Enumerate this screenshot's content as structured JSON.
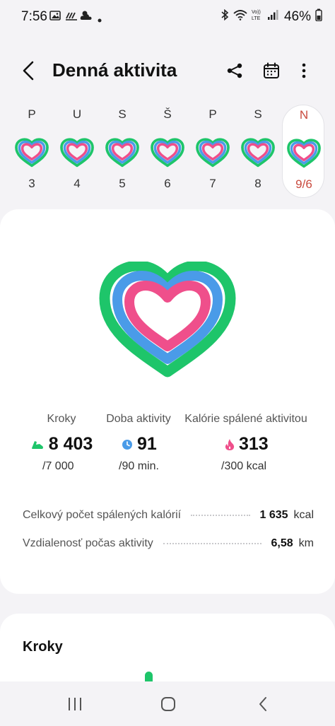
{
  "status": {
    "time": "7:56",
    "battery": "46%",
    "icons": [
      "image-icon",
      "weather-icon",
      "cloud-icon",
      "dot-icon",
      "bluetooth-icon",
      "wifi-icon",
      "volte-icon",
      "signal-icon",
      "battery-icon"
    ]
  },
  "header": {
    "title": "Denná aktivita",
    "back_icon": "back-arrow-icon",
    "actions": [
      "share-icon",
      "calendar-icon",
      "more-icon"
    ]
  },
  "week": [
    {
      "letter": "P",
      "date": "3",
      "selected": false
    },
    {
      "letter": "U",
      "date": "4",
      "selected": false
    },
    {
      "letter": "S",
      "date": "5",
      "selected": false
    },
    {
      "letter": "Š",
      "date": "6",
      "selected": false
    },
    {
      "letter": "P",
      "date": "7",
      "selected": false
    },
    {
      "letter": "S",
      "date": "8",
      "selected": false
    },
    {
      "letter": "N",
      "date": "9/6",
      "selected": true
    }
  ],
  "colors": {
    "steps": "#1ec56a",
    "active_time": "#4a9be8",
    "calories": "#ef4f8b",
    "selected_day": "#c94a3e"
  },
  "summary": {
    "stats": [
      {
        "label": "Kroky",
        "value": "8 403",
        "goal": "/7 000",
        "icon": "shoe-icon"
      },
      {
        "label": "Doba aktivity",
        "value": "91",
        "goal": "/90 min.",
        "icon": "clock-icon"
      },
      {
        "label": "Kalórie spálené aktivitou",
        "value": "313",
        "goal": "/300 kcal",
        "icon": "flame-icon"
      }
    ],
    "details": [
      {
        "label": "Celkový počet spálených kalórií",
        "value": "1 635",
        "unit": "kcal"
      },
      {
        "label": "Vzdialenosť počas aktivity",
        "value": "6,58",
        "unit": "km"
      }
    ]
  },
  "steps_section": {
    "title": "Kroky"
  },
  "nav": [
    "recents-icon",
    "home-icon",
    "back-icon"
  ]
}
